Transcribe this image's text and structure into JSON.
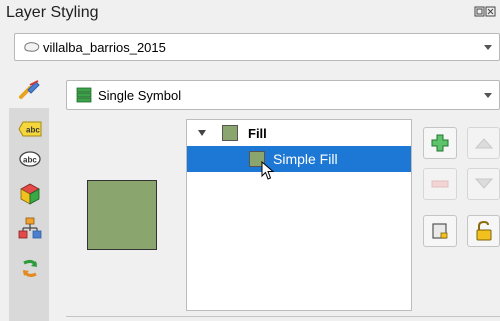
{
  "panel": {
    "title": "Layer Styling",
    "title_buttons": "⊡⊠"
  },
  "layer_combo": {
    "value": "villalba_barrios_2015",
    "icon": "polygon-layer-icon"
  },
  "renderer_combo": {
    "value": "Single Symbol",
    "icon": "single-symbol-icon"
  },
  "sidebar": {
    "items": [
      {
        "name": "symbology-tab",
        "icon": "paint-brush-icon"
      },
      {
        "name": "labels-tab",
        "icon": "labels-icon",
        "text": "abc"
      },
      {
        "name": "masks-tab",
        "icon": "mask-labels-icon",
        "text": "abc"
      },
      {
        "name": "3d-view-tab",
        "icon": "cube-3d-icon"
      },
      {
        "name": "diagrams-tab",
        "icon": "diagram-icon"
      },
      {
        "name": "history-tab",
        "icon": "history-icon"
      }
    ]
  },
  "symbol_tree": {
    "root": {
      "label": "Fill",
      "expanded": true
    },
    "child": {
      "label": "Simple Fill",
      "selected": true
    }
  },
  "colors": {
    "symbol_fill": "#8aa66e",
    "selection": "#1c78d4",
    "add_green": "#38a347"
  }
}
